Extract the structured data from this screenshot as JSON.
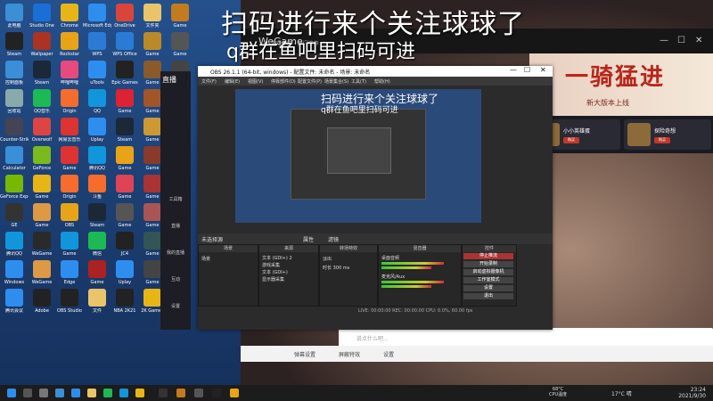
{
  "overlay": {
    "title": "扫码进行来个关注球球了",
    "subtitle": "q群在鱼吧里扫码可进"
  },
  "desktop": {
    "icons": [
      {
        "label": "此电脑",
        "color": "#3a8fd6"
      },
      {
        "label": "Studio One",
        "color": "#1a6fd6"
      },
      {
        "label": "Chrome",
        "color": "#e8b517"
      },
      {
        "label": "Microsoft Edge",
        "color": "#2e8ef0"
      },
      {
        "label": "OneDrive",
        "color": "#d9453a"
      },
      {
        "label": "文件夹",
        "color": "#e9c46a"
      },
      {
        "label": "Game",
        "color": "#c47a1e"
      },
      {
        "label": "Steam",
        "color": "#222"
      },
      {
        "label": "Wallpaper",
        "color": "#a32"
      },
      {
        "label": "Rockstar",
        "color": "#e8a317"
      },
      {
        "label": "WPS",
        "color": "#2b7bd6"
      },
      {
        "label": "WPS Office",
        "color": "#2b7bd6"
      },
      {
        "label": "Game",
        "color": "#b88a2a"
      },
      {
        "label": "Game",
        "color": "#555"
      },
      {
        "label": "控制面板",
        "color": "#3a8fd6"
      },
      {
        "label": "Steam",
        "color": "#1b2838"
      },
      {
        "label": "哔哩哔哩",
        "color": "#e84a7f"
      },
      {
        "label": "uTools",
        "color": "#2e8ef0"
      },
      {
        "label": "Epic Games",
        "color": "#222"
      },
      {
        "label": "Game",
        "color": "#8a5a2a"
      },
      {
        "label": "Game",
        "color": "#444"
      },
      {
        "label": "回收站",
        "color": "#8aa"
      },
      {
        "label": "QQ音乐",
        "color": "#1db954"
      },
      {
        "label": "Origin",
        "color": "#f56c2d"
      },
      {
        "label": "QQ",
        "color": "#1296db"
      },
      {
        "label": "Game",
        "color": "#d23"
      },
      {
        "label": "Game",
        "color": "#a3552a"
      },
      {
        "label": "Game",
        "color": "#333"
      },
      {
        "label": "Counter-Strike",
        "color": "#445"
      },
      {
        "label": "Overwolf",
        "color": "#d44"
      },
      {
        "label": "网易云音乐",
        "color": "#d33"
      },
      {
        "label": "Uplay",
        "color": "#2e8ef0"
      },
      {
        "label": "Steam",
        "color": "#1b2838"
      },
      {
        "label": "Game",
        "color": "#c93"
      },
      {
        "label": "Game",
        "color": "#555"
      },
      {
        "label": "Calculator",
        "color": "#3a8fd6"
      },
      {
        "label": "GeForce",
        "color": "#7aba1e"
      },
      {
        "label": "Game",
        "color": "#d33"
      },
      {
        "label": "腾讯QQ",
        "color": "#1296db"
      },
      {
        "label": "Game",
        "color": "#e8a317"
      },
      {
        "label": "Game",
        "color": "#8a3a2a"
      },
      {
        "label": "Game",
        "color": "#444"
      },
      {
        "label": "GeForce Experience",
        "color": "#76b900"
      },
      {
        "label": "Game",
        "color": "#e8b517"
      },
      {
        "label": "Origin",
        "color": "#f56c2d"
      },
      {
        "label": "斗鱼",
        "color": "#f56c2d"
      },
      {
        "label": "Game",
        "color": "#d45"
      },
      {
        "label": "Game",
        "color": "#a33"
      },
      {
        "label": "Game",
        "color": "#333"
      },
      {
        "label": "GE",
        "color": "#333"
      },
      {
        "label": "Game",
        "color": "#d94"
      },
      {
        "label": "OBS",
        "color": "#e8a317"
      },
      {
        "label": "Steam",
        "color": "#1b2838"
      },
      {
        "label": "Game",
        "color": "#555"
      },
      {
        "label": "Game",
        "color": "#a55"
      },
      {
        "label": "Game",
        "color": "#444"
      },
      {
        "label": "腾讯QQ",
        "color": "#1296db"
      },
      {
        "label": "WeGame",
        "color": "#2a2a2a"
      },
      {
        "label": "Game",
        "color": "#1296db"
      },
      {
        "label": "微信",
        "color": "#1db954"
      },
      {
        "label": "JC4",
        "color": "#222"
      },
      {
        "label": "Game",
        "color": "#355"
      },
      {
        "label": "Game",
        "color": "#444"
      },
      {
        "label": "Windows",
        "color": "#2e8ef0"
      },
      {
        "label": "WeGame",
        "color": "#d94"
      },
      {
        "label": "Edge",
        "color": "#2e8ef0"
      },
      {
        "label": "Game",
        "color": "#a22"
      },
      {
        "label": "Uplay",
        "color": "#2e8ef0"
      },
      {
        "label": "Game",
        "color": "#444"
      },
      {
        "label": "Game",
        "color": "#444"
      },
      {
        "label": "腾讯会议",
        "color": "#2e8ef0"
      },
      {
        "label": "Adobe",
        "color": "#222"
      },
      {
        "label": "OBS Studio",
        "color": "#222"
      },
      {
        "label": "文件",
        "color": "#e9c46a"
      },
      {
        "label": "NBA 2K21",
        "color": "#222"
      },
      {
        "label": "2K Games",
        "color": "#e8b517"
      },
      {
        "label": "Game",
        "color": "#444"
      }
    ]
  },
  "wegame": {
    "brand": "WeGame",
    "subtitle": "游戏专区 · 热门推荐",
    "promo_title": "一骑猛进",
    "promo_sub": "新大版本上线",
    "card1_title": "小小英雄蛋",
    "card2_title": "探险奇想",
    "tag": "购买",
    "chat_placeholder": "说点什么吧...",
    "tool1": "弹幕设置",
    "tool2": "屏蔽特效",
    "tool3": "设置"
  },
  "companion": {
    "logo": "直播",
    "items": [
      "工具箱",
      "直播",
      "我的直播",
      "互动",
      "设置"
    ]
  },
  "obs": {
    "title": "OBS 26.1.1 (64-bit, windows) - 配置文件: 未命名 - 场景: 未命名",
    "menu": [
      "文件(F)",
      "编辑(E)",
      "视图(V)",
      "停靠部件(D)",
      "配置文件(P)",
      "场景集合(S)",
      "工具(T)",
      "帮助(H)"
    ],
    "source_bar": "未选择源",
    "props_label": "属性",
    "filters_label": "滤镜",
    "docks": {
      "scenes": {
        "header": "场景",
        "rows": [
          "场景"
        ]
      },
      "sources": {
        "header": "来源",
        "rows": [
          "文本 (GDI+) 2",
          "游戏采集",
          "文本 (GDI+)",
          "显示器采集"
        ]
      },
      "transitions": {
        "header": "转场特效",
        "rows": [
          "淡出",
          "时长  300 ms"
        ]
      },
      "mixer": {
        "header": "混音器",
        "rows": [
          "桌面音频",
          "麦克风/Aux"
        ]
      },
      "controls": {
        "header": "控件"
      }
    },
    "controls": [
      "停止推流",
      "开始录制",
      "启动虚拟摄像机",
      "工作室模式",
      "设置",
      "退出"
    ],
    "status": "LIVE: 00:00:00    REC: 00:00:00    CPU: 0.0%, 60.00 fps"
  },
  "preview": {
    "text1": "扫码进行来个关注球球了",
    "text2": "q群在鱼吧里扫码可进"
  },
  "taskbar": {
    "tray_temp": "68°C",
    "tray_cpu": "CPU温度",
    "weather": "17°C 晴",
    "time": "23:24",
    "date": "2021/9/30"
  }
}
